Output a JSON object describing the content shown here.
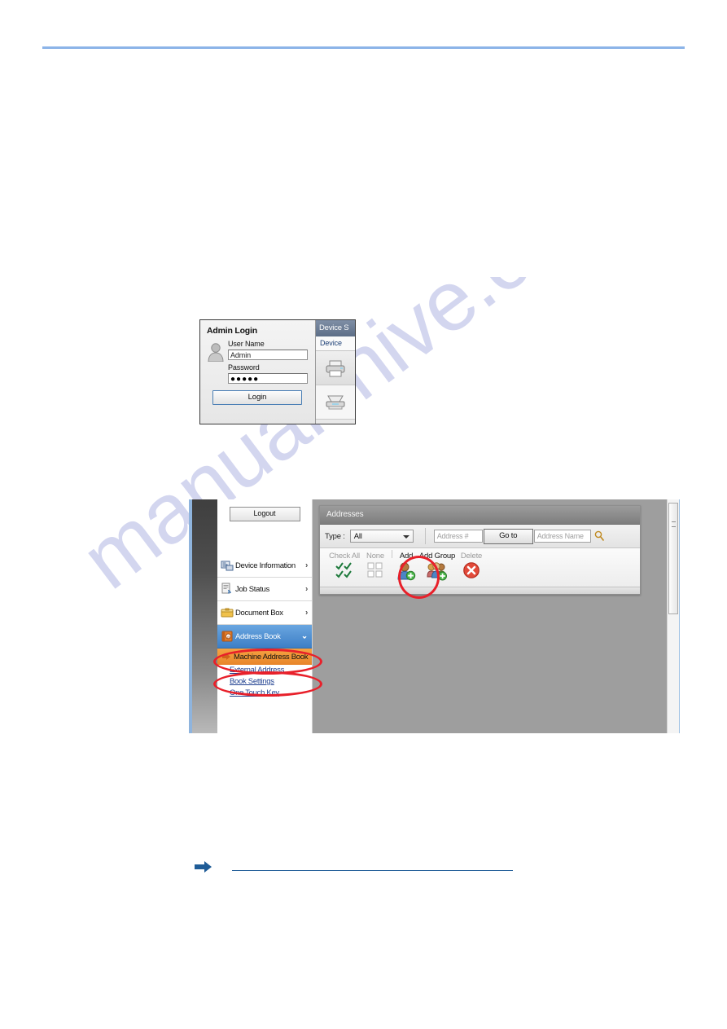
{
  "page": {
    "header_text": "",
    "watermark": "manualshive.com",
    "rule_color": "#8cb4e8"
  },
  "admin_login": {
    "title": "Admin Login",
    "avatar_icon": "user-avatar-icon",
    "username_label": "User Name",
    "username_value": "Admin",
    "password_label": "Password",
    "password_value": "●●●●●",
    "login_button": "Login",
    "side_panel": {
      "header": "Device S",
      "tab": "Device",
      "printer_icon": "printer-icon",
      "scanner_icon": "scanner-icon"
    }
  },
  "web_server": {
    "logout_button": "Logout",
    "nav_items": [
      {
        "label": "Device Information",
        "icon": "device-information-icon",
        "chevron": "›",
        "selected": false
      },
      {
        "label": "Job Status",
        "icon": "job-status-icon",
        "chevron": "›",
        "selected": false
      },
      {
        "label": "Document Box",
        "icon": "document-box-icon",
        "chevron": "›",
        "selected": false
      },
      {
        "label": "Address Book",
        "icon": "address-book-icon",
        "chevron": "⌄",
        "selected": true
      }
    ],
    "nav_sub_item": {
      "label": "Machine Address Book",
      "bullet_icon": "orange-arrow-icon"
    },
    "nav_links": [
      "External Address",
      "Book Settings",
      "One Touch Key"
    ],
    "panel": {
      "title": "Addresses",
      "type_label": "Type :",
      "type_value": "All",
      "address_number_placeholder": "Address #",
      "goto_button": "Go to",
      "address_name_placeholder": "Address Name",
      "search_icon": "magnifier-icon",
      "toolbar": [
        {
          "label": "Check All",
          "icon": "check-all-icon",
          "active": false
        },
        {
          "label": "None",
          "icon": "select-none-icon",
          "active": false
        },
        {
          "label": "Add",
          "icon": "add-contact-icon",
          "active": true
        },
        {
          "label": "Add Group",
          "icon": "add-group-icon",
          "active": true
        },
        {
          "label": "Delete",
          "icon": "delete-icon",
          "active": false
        }
      ]
    },
    "scrollbar": "vertical-scrollbar"
  },
  "cross_reference": {
    "arrow_icon": "blue-right-arrow-icon",
    "link_text": ""
  },
  "colors": {
    "accent_blue": "#8cb4e8",
    "selected_nav": "#3d7fc6",
    "sub_nav_orange": "#e8852a",
    "annotation_red": "#e8202a",
    "link_blue": "#1e3f8f",
    "watermark": "#b9bde6"
  }
}
